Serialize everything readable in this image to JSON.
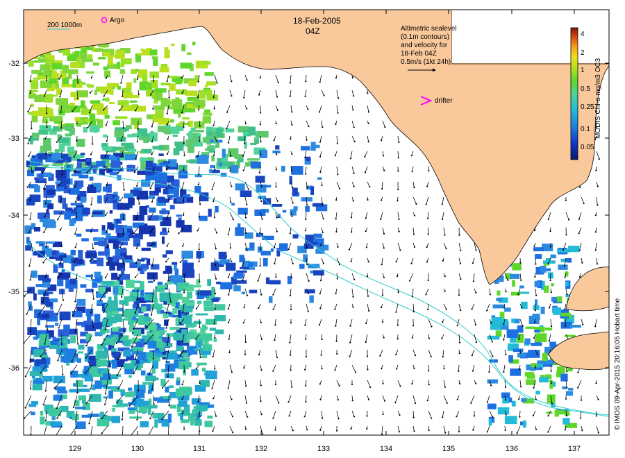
{
  "map": {
    "date": "18-Feb-2005",
    "time": "04Z",
    "legend_lines": [
      "Altimetric sealevel",
      "(0.1m contours)",
      "and velocity for",
      "18-Feb 04Z",
      "0.5m/s (1kt 24h)"
    ],
    "drifter_label": "drifter",
    "argo_label": "Argo",
    "isobath_label": "200  1000m",
    "credit": "© IMOS 09-Apr-2015 20:16:05 Hobart time",
    "colorbar": {
      "title": "MODIS Chl-a mg/m3 OC3",
      "ticks": [
        "0.05",
        "0.1",
        "0.25",
        "0.5",
        "1",
        "2",
        "4"
      ]
    },
    "lon_ticks": [
      "129",
      "130",
      "131",
      "132",
      "133",
      "134",
      "135",
      "136",
      "137"
    ],
    "lat_ticks": [
      "-32",
      "-33",
      "-34",
      "-35",
      "-36"
    ],
    "colors": {
      "land": "#f9c89b",
      "isobath": "#33cccc",
      "argo": "#ff00ff",
      "drifter": "#ff00ff"
    }
  }
}
